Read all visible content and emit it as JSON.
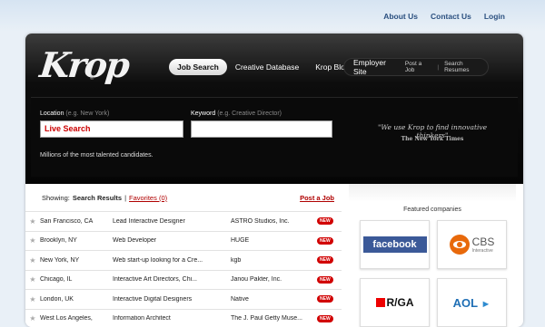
{
  "topnav": {
    "about": "About Us",
    "contact": "Contact Us",
    "login": "Login"
  },
  "brand": {
    "logo": "Krop",
    "reg": "®"
  },
  "mainnav": {
    "tabs": [
      "Job Search",
      "Creative Database",
      "Krop Blog"
    ],
    "employer_site": "Employer Site",
    "post_job": "Post a Job",
    "separator": "|",
    "search_resumes": "Search Resumes"
  },
  "search": {
    "location_label": "Location",
    "location_hint": "(e.g. New York)",
    "location_value": "Live Search",
    "keyword_label": "Keyword",
    "keyword_hint": "(e.g. Creative Director)",
    "keyword_value": "",
    "tagline": "Millions of the most talented candidates.",
    "quote": "\"We use Krop to find innovative thinkers\"",
    "quote_source": "The New York Times"
  },
  "results": {
    "showing_label": "Showing:",
    "search_results": "Search Results",
    "separator": "|",
    "favorites": "Favorites (0)",
    "post_job": "Post a Job",
    "badge": "NEW",
    "rows": [
      {
        "location": "San Francisco, CA",
        "title": "Lead Interactive Designer",
        "company": "ASTRO Studios, Inc."
      },
      {
        "location": "Brooklyn, NY",
        "title": "Web Developer",
        "company": "HUGE"
      },
      {
        "location": "New York, NY",
        "title": "Web start-up looking for a Cre...",
        "company": "kgb"
      },
      {
        "location": "Chicago, IL",
        "title": "Interactive Art Directors, Chi...",
        "company": "Janou Pakter, Inc."
      },
      {
        "location": "London, UK",
        "title": "Interactive Digital Designers",
        "company": "Native"
      },
      {
        "location": "West Los Angeles,",
        "title": "Information Architect",
        "company": "The J. Paul Getty Muse..."
      }
    ]
  },
  "featured": {
    "heading": "Featured companies",
    "companies": [
      {
        "name": "facebook"
      },
      {
        "name": "CBS",
        "sub": "Interactive"
      },
      {
        "name": "R/GA"
      },
      {
        "name": "AOL"
      }
    ]
  },
  "colors": {
    "accent_red": "#b00000",
    "badge_red": "#d10000",
    "facebook_blue": "#3b5998",
    "cbs_orange": "#e8690b",
    "aol_blue": "#1f6fb5"
  }
}
